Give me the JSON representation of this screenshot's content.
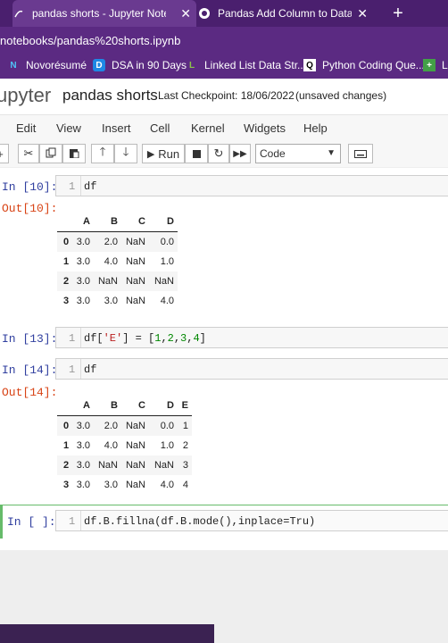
{
  "browser": {
    "tabs": [
      {
        "label": "pandas shorts - Jupyter Notebook",
        "active": true
      },
      {
        "label": "Pandas Add Column to DataFrame",
        "active": false
      }
    ],
    "url": "notebooks/pandas%20shorts.ipynb",
    "bookmarks": [
      {
        "label": "Novorésumé",
        "icon": "N"
      },
      {
        "label": "DSA in 90 Days",
        "icon": "D"
      },
      {
        "label": "Linked List Data Str...",
        "icon": "L"
      },
      {
        "label": "Python Coding Que...",
        "icon": "Q"
      },
      {
        "label": "Le",
        "icon": "+"
      }
    ]
  },
  "jupyter": {
    "logo_text": "upyter",
    "notebook_name": "pandas shorts",
    "checkpoint": "Last Checkpoint: 18/06/2022",
    "unsaved": "(unsaved changes)",
    "menu": [
      "Edit",
      "View",
      "Insert",
      "Cell",
      "Kernel",
      "Widgets",
      "Help"
    ],
    "toolbar": {
      "run_label": "Run",
      "cell_type": "Code"
    }
  },
  "cells": [
    {
      "in_prompt": "In [10]:",
      "line_no": "1",
      "code": "df",
      "out_prompt": "Out[10]:"
    },
    {
      "in_prompt": "In [13]:",
      "line_no": "1",
      "code_parts": [
        "df[",
        "'E'",
        "] = [",
        "1",
        ",",
        "2",
        ",",
        "3",
        ",",
        "4",
        "]"
      ]
    },
    {
      "in_prompt": "In [14]:",
      "line_no": "1",
      "code": "df",
      "out_prompt": "Out[14]:"
    },
    {
      "in_prompt": "In [ ]:",
      "line_no": "1",
      "code": "df.B.fillna(df.B.mode(),inplace=Tru)"
    }
  ],
  "table1": {
    "columns": [
      "A",
      "B",
      "C",
      "D"
    ],
    "rows": [
      {
        "index": "0",
        "values": [
          "3.0",
          "2.0",
          "NaN",
          "0.0"
        ]
      },
      {
        "index": "1",
        "values": [
          "3.0",
          "4.0",
          "NaN",
          "1.0"
        ]
      },
      {
        "index": "2",
        "values": [
          "3.0",
          "NaN",
          "NaN",
          "NaN"
        ]
      },
      {
        "index": "3",
        "values": [
          "3.0",
          "3.0",
          "NaN",
          "4.0"
        ]
      }
    ]
  },
  "table2": {
    "columns": [
      "A",
      "B",
      "C",
      "D",
      "E"
    ],
    "rows": [
      {
        "index": "0",
        "values": [
          "3.0",
          "2.0",
          "NaN",
          "0.0",
          "1"
        ]
      },
      {
        "index": "1",
        "values": [
          "3.0",
          "4.0",
          "NaN",
          "1.0",
          "2"
        ]
      },
      {
        "index": "2",
        "values": [
          "3.0",
          "NaN",
          "NaN",
          "NaN",
          "3"
        ]
      },
      {
        "index": "3",
        "values": [
          "3.0",
          "3.0",
          "NaN",
          "4.0",
          "4"
        ]
      }
    ]
  }
}
